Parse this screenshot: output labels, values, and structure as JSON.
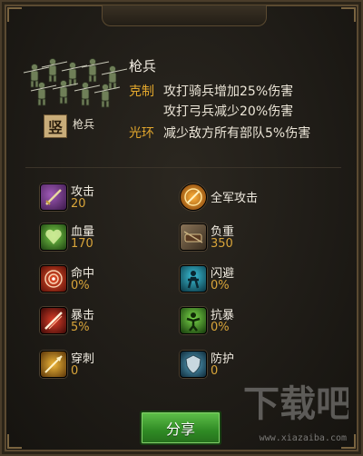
{
  "unit": {
    "name": "枪兵",
    "badge_char": "竖",
    "badge_label": "枪兵"
  },
  "traits": {
    "counter_keyword": "克制",
    "counter_line1": "攻打骑兵增加25%伤害",
    "counter_line2": "攻打弓兵减少20%伤害",
    "aura_keyword": "光环",
    "aura_line": "减少敌方所有部队5%伤害"
  },
  "stats": [
    {
      "label": "攻击",
      "value": "20",
      "icon": "sword-icon",
      "color": "#5a2a6a"
    },
    {
      "label": "全军攻击",
      "value": "",
      "icon": "army-attack-icon",
      "color": "#c77a1a"
    },
    {
      "label": "血量",
      "value": "170",
      "icon": "heart-icon",
      "color": "#2f6a1e"
    },
    {
      "label": "负重",
      "value": "350",
      "icon": "load-icon",
      "color": "#5a4a38"
    },
    {
      "label": "命中",
      "value": "0%",
      "icon": "target-icon",
      "color": "#a02a1a"
    },
    {
      "label": "闪避",
      "value": "0%",
      "icon": "dodge-icon",
      "color": "#1f6f80"
    },
    {
      "label": "暴击",
      "value": "5%",
      "icon": "crit-icon",
      "color": "#8a1a1a"
    },
    {
      "label": "抗暴",
      "value": "0%",
      "icon": "anti-crit-icon",
      "color": "#3f7a1f"
    },
    {
      "label": "穿刺",
      "value": "0",
      "icon": "pierce-icon",
      "color": "#b3781c"
    },
    {
      "label": "防护",
      "value": "0",
      "icon": "shield-icon",
      "color": "#2e5f7a"
    }
  ],
  "share_button": "分享",
  "watermark": {
    "logo": "下载吧",
    "url": "www.xiazaiba.com"
  }
}
